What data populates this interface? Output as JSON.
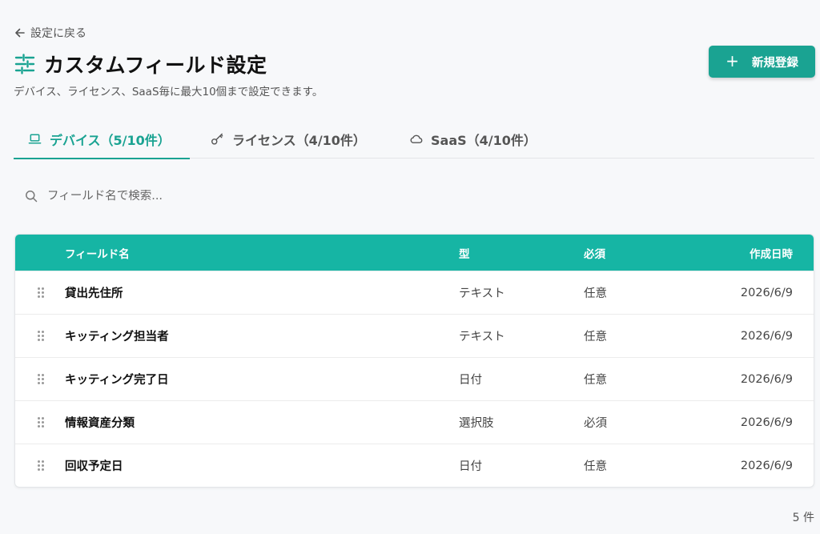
{
  "nav": {
    "back_label": "設定に戻る"
  },
  "header": {
    "title": "カスタムフィールド設定",
    "subtitle": "デバイス、ライセンス、SaaS毎に最大10個まで設定できます。",
    "new_button_label": "新規登録",
    "new_button_icon": "+"
  },
  "tabs": [
    {
      "label": "デバイス（5/10件）",
      "icon": "laptop-icon",
      "active": true
    },
    {
      "label": "ライセンス（4/10件）",
      "icon": "key-icon",
      "active": false
    },
    {
      "label": "SaaS（4/10件）",
      "icon": "cloud-icon",
      "active": false
    }
  ],
  "search": {
    "placeholder": "フィールド名で検索...",
    "value": ""
  },
  "table": {
    "columns": {
      "name": "フィールド名",
      "type": "型",
      "required": "必須",
      "created": "作成日時"
    },
    "rows": [
      {
        "name": "貸出先住所",
        "type": "テキスト",
        "required": "任意",
        "created": "2026/6/9"
      },
      {
        "name": "キッティング担当者",
        "type": "テキスト",
        "required": "任意",
        "created": "2026/6/9"
      },
      {
        "name": "キッティング完了日",
        "type": "日付",
        "required": "任意",
        "created": "2026/6/9"
      },
      {
        "name": "情報資産分類",
        "type": "選択肢",
        "required": "必須",
        "created": "2026/6/9"
      },
      {
        "name": "回収予定日",
        "type": "日付",
        "required": "任意",
        "created": "2026/6/9"
      }
    ]
  },
  "footer": {
    "count_label": "5 件"
  },
  "colors": {
    "accent": "#1aa392",
    "header_bg": "#16b5a4",
    "page_bg": "#f7f8fa"
  }
}
